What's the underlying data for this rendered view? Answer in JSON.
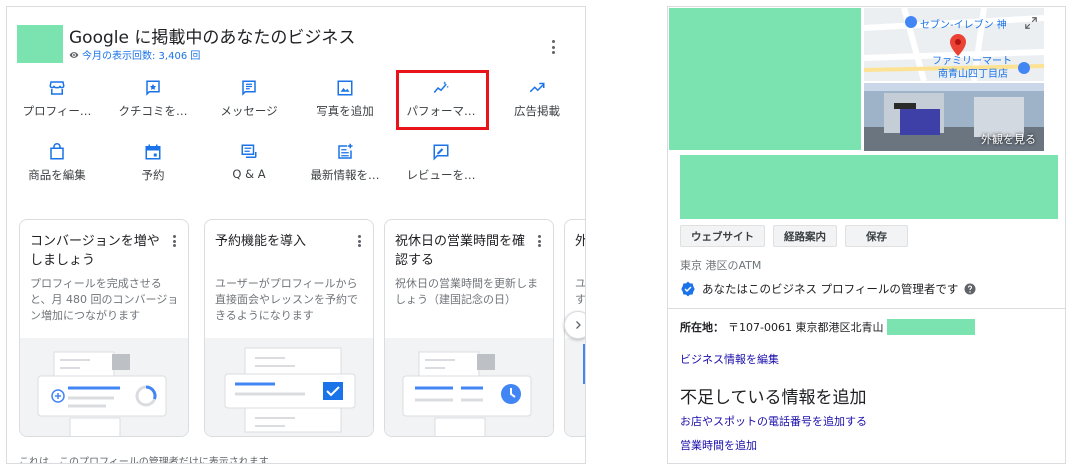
{
  "header": {
    "title": "Google に掲載中のあなたのビジネス",
    "views": "今月の表示回数: 3,406 回"
  },
  "actions": [
    {
      "label": "プロフィー…",
      "icon": "storefront-icon"
    },
    {
      "label": "クチコミを…",
      "icon": "review-star-icon"
    },
    {
      "label": "メッセージ",
      "icon": "message-icon"
    },
    {
      "label": "写真を追加",
      "icon": "photo-icon"
    },
    {
      "label": "パフォーマ…",
      "icon": "performance-icon"
    },
    {
      "label": "広告掲載",
      "icon": "trending-up-icon"
    },
    {
      "label": "商品を編集",
      "icon": "shopping-bag-icon"
    },
    {
      "label": "予約",
      "icon": "calendar-icon"
    },
    {
      "label": "Q & A",
      "icon": "qa-icon"
    },
    {
      "label": "最新情報を…",
      "icon": "post-add-icon"
    },
    {
      "label": "レビューを…",
      "icon": "rate-review-icon"
    }
  ],
  "cards": [
    {
      "title": "コンバージョンを増やしましょう",
      "desc": "プロフィールを完成させると、月 480 回のコンバージョン増加につながります"
    },
    {
      "title": "予約機能を導入",
      "desc": "ユーザーがプロフィールから直接面会やレッスンを予約できるようになります"
    },
    {
      "title": "祝休日の営業時間を確認する",
      "desc": "祝休日の営業時間を更新しましょう（建国記念の日）"
    },
    {
      "title": "外",
      "desc": "ユす"
    }
  ],
  "footer_note": "これは、このプロフィールの管理者だけに表示されます",
  "side_panel": {
    "map_labels": {
      "store1": "セブン-イレブン 神",
      "store2a": "ファミリーマート",
      "store2b": "南青山四丁目店"
    },
    "exterior_label": "外観を見る",
    "buttons": {
      "website": "ウェブサイト",
      "directions": "経路案内",
      "save": "保存"
    },
    "category": "東京 港区のATM",
    "verified_text": "あなたはこのビジネス プロフィールの管理者です",
    "address_label": "所在地：",
    "address_value": "〒107-0061 東京都港区北青山",
    "edit_link": "ビジネス情報を編集",
    "missing_heading": "不足している情報を追加",
    "add_phone_link": "お店やスポットの電話番号を追加する",
    "add_hours_link": "営業時間を追加"
  },
  "colors": {
    "accent": "#1a73e8",
    "highlight": "#e8141a",
    "redacted": "#7be3b0"
  }
}
